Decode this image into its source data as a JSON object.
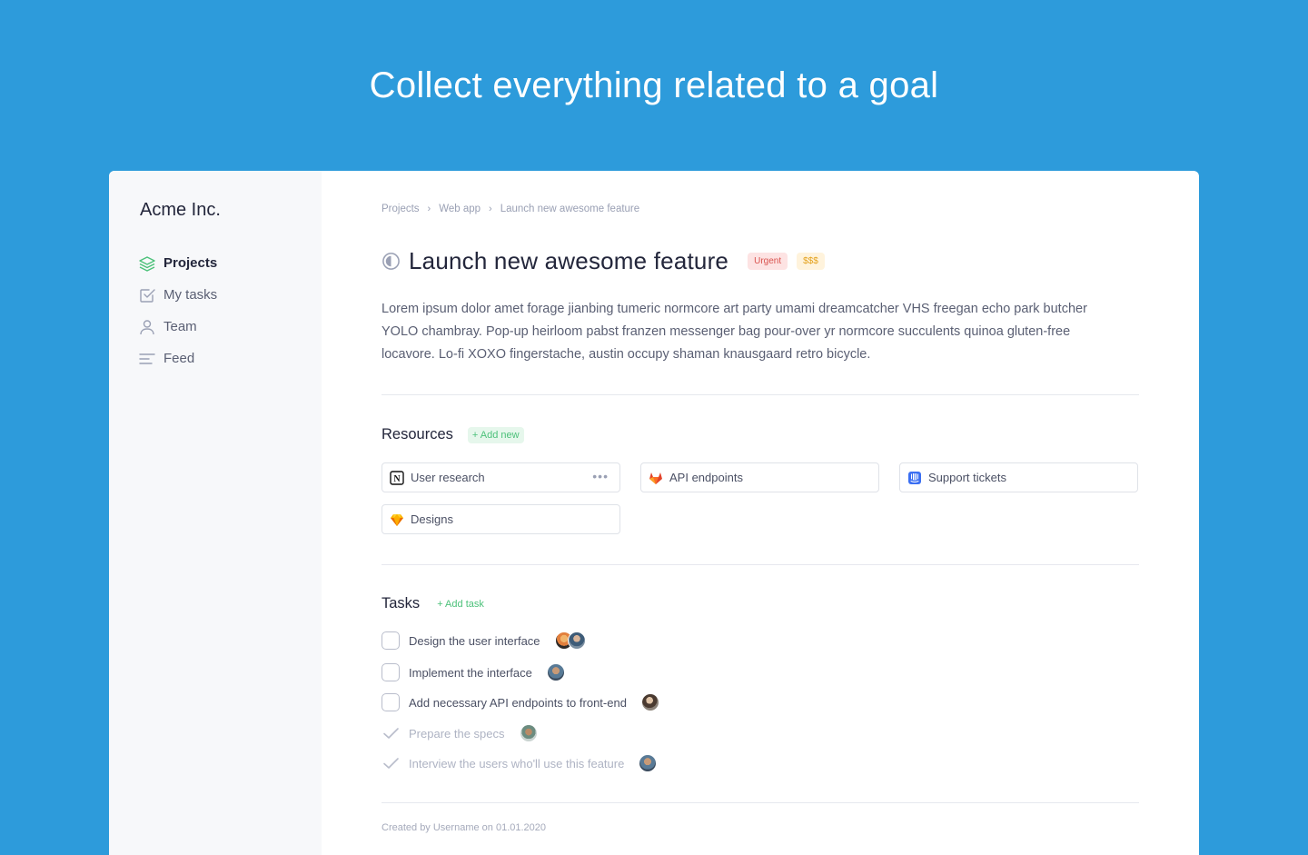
{
  "hero": {
    "title": "Collect everything related to a goal"
  },
  "sidebar": {
    "brand": "Acme Inc.",
    "items": [
      {
        "label": "Projects",
        "icon": "layers-icon",
        "active": true
      },
      {
        "label": "My tasks",
        "icon": "checkbox-icon",
        "active": false
      },
      {
        "label": "Team",
        "icon": "user-icon",
        "active": false
      },
      {
        "label": "Feed",
        "icon": "feed-icon",
        "active": false
      }
    ]
  },
  "breadcrumb": [
    "Projects",
    "Web app",
    "Launch new awesome feature"
  ],
  "project": {
    "title": "Launch new awesome feature",
    "badges": {
      "urgent": "Urgent",
      "cost": "$$$"
    },
    "description": "Lorem ipsum dolor amet forage jianbing tumeric normcore art party umami dreamcatcher VHS freegan echo park butcher YOLO chambray. Pop-up heirloom pabst franzen messenger bag pour-over yr normcore succulents quinoa gluten-free locavore. Lo-fi XOXO fingerstache, austin occupy shaman knausgaard retro bicycle."
  },
  "resources": {
    "title": "Resources",
    "add_label": "+ Add new",
    "items": [
      {
        "label": "User research",
        "icon": "notion-icon",
        "more": "•••"
      },
      {
        "label": "API endpoints",
        "icon": "gitlab-icon"
      },
      {
        "label": "Support tickets",
        "icon": "intercom-icon"
      },
      {
        "label": "Designs",
        "icon": "sketch-icon"
      }
    ]
  },
  "tasks": {
    "title": "Tasks",
    "add_label": "+ Add task",
    "items": [
      {
        "label": "Design the user interface",
        "done": false
      },
      {
        "label": "Implement the interface",
        "done": false
      },
      {
        "label": "Add necessary API endpoints to front-end",
        "done": false
      },
      {
        "label": "Prepare the specs",
        "done": true
      },
      {
        "label": "Interview the users who'll use this feature",
        "done": true
      }
    ]
  },
  "footer": {
    "created": "Created by Username on 01.01.2020"
  },
  "colors": {
    "background": "#2d9bdb",
    "accent_green": "#4cc17a",
    "urgent": "#d9534f",
    "cost": "#e4a11b"
  }
}
